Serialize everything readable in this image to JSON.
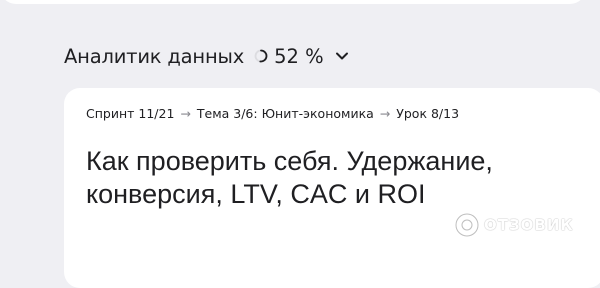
{
  "course": {
    "title": "Аналитик данных",
    "progress_percent": 52,
    "progress_label": "52 %"
  },
  "breadcrumb": {
    "sprint": "Спринт 11/21",
    "topic": "Тема 3/6: Юнит-экономика",
    "lesson": "Урок 8/13",
    "separator": "→"
  },
  "lesson": {
    "title_line1": "Как проверить себя. Удержание,",
    "title_line2": "конверсия, LTV, CAC и ROI"
  },
  "watermark": {
    "text": "ОТЗОВИК"
  },
  "colors": {
    "background": "#efeff3",
    "card": "#ffffff",
    "text": "#1f1f22"
  }
}
